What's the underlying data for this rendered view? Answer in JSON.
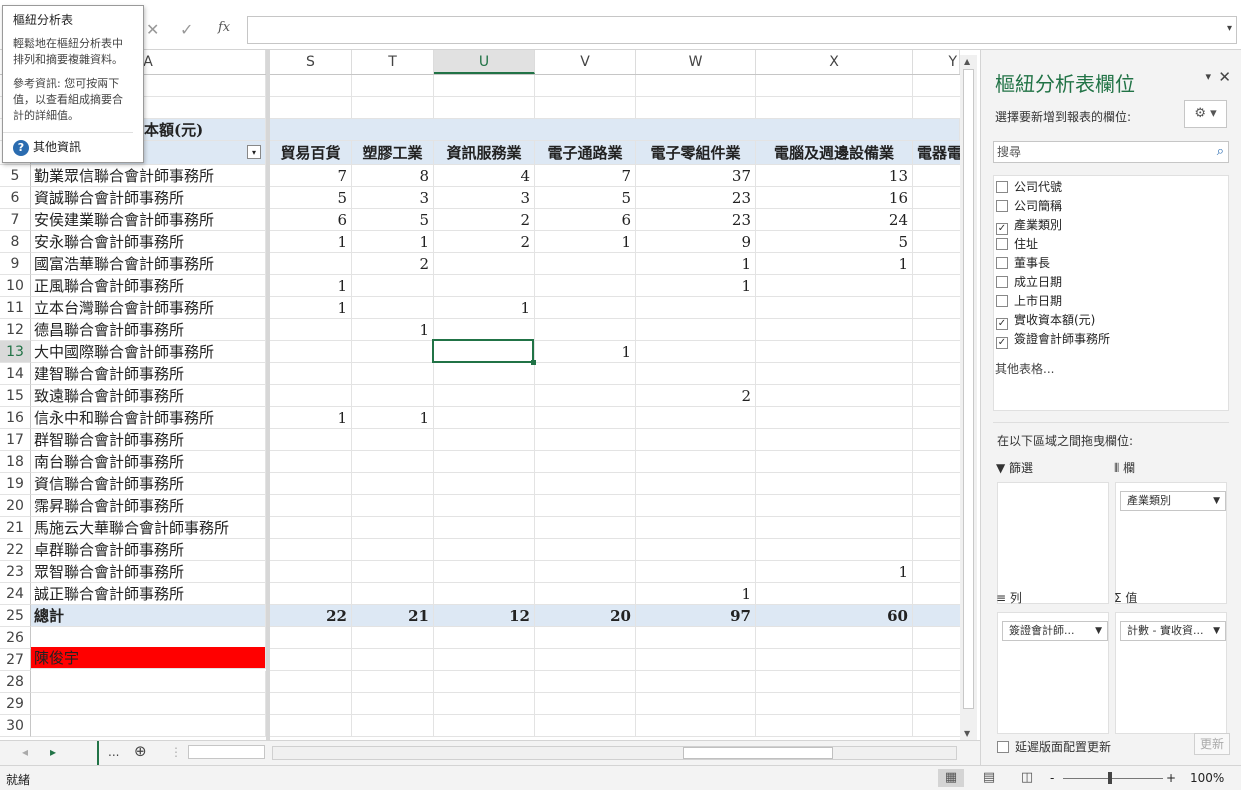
{
  "tooltip": {
    "title": "樞紐分析表",
    "body": "輕鬆地在樞紐分析表中排列和摘要複雜資料。",
    "body2": "參考資訊: 您可按兩下值，以查看組成摘要合計的詳細值。",
    "link": "其他資訊"
  },
  "formula": {
    "cancel": "✕",
    "enter": "✓",
    "fx": "fx",
    "value": ""
  },
  "columns": {
    "A": "A",
    "S": "S",
    "T": "T",
    "U": "U",
    "V": "V",
    "W": "W",
    "X": "X",
    "Y": "Y"
  },
  "rows": [
    "5",
    "6",
    "7",
    "8",
    "9",
    "10",
    "11",
    "12",
    "13",
    "14",
    "15",
    "16",
    "17",
    "18",
    "19",
    "20",
    "21",
    "22",
    "23",
    "24",
    "25",
    "26",
    "27",
    "28",
    "29",
    "30"
  ],
  "pivot": {
    "value_header": "本額(元)",
    "categories": [
      "貿易百貨",
      "塑膠工業",
      "資訊服務業",
      "電子通路業",
      "電子零組件業",
      "電腦及週邊設備業",
      "電器電"
    ],
    "firms": [
      {
        "name": "勤業眾信聯合會計師事務所",
        "v": [
          "7",
          "8",
          "4",
          "7",
          "37",
          "13"
        ]
      },
      {
        "name": "資誠聯合會計師事務所",
        "v": [
          "5",
          "3",
          "3",
          "5",
          "23",
          "16"
        ]
      },
      {
        "name": "安侯建業聯合會計師事務所",
        "v": [
          "6",
          "5",
          "2",
          "6",
          "23",
          "24"
        ]
      },
      {
        "name": "安永聯合會計師事務所",
        "v": [
          "1",
          "1",
          "2",
          "1",
          "9",
          "5"
        ]
      },
      {
        "name": "國富浩華聯合會計師事務所",
        "v": [
          "",
          "2",
          "",
          "",
          "1",
          "1"
        ]
      },
      {
        "name": "正風聯合會計師事務所",
        "v": [
          "1",
          "",
          "",
          "",
          "1",
          ""
        ]
      },
      {
        "name": "立本台灣聯合會計師事務所",
        "v": [
          "1",
          "",
          "1",
          "",
          "",
          ""
        ]
      },
      {
        "name": "德昌聯合會計師事務所",
        "v": [
          "",
          "1",
          "",
          "",
          "",
          ""
        ]
      },
      {
        "name": "大中國際聯合會計師事務所",
        "v": [
          "",
          "",
          "",
          "1",
          "",
          ""
        ]
      },
      {
        "name": "建智聯合會計師事務所",
        "v": [
          "",
          "",
          "",
          "",
          "",
          ""
        ]
      },
      {
        "name": "致遠聯合會計師事務所",
        "v": [
          "",
          "",
          "",
          "",
          "2",
          ""
        ]
      },
      {
        "name": "信永中和聯合會計師事務所",
        "v": [
          "1",
          "1",
          "",
          "",
          "",
          ""
        ]
      },
      {
        "name": "群智聯合會計師事務所",
        "v": [
          "",
          "",
          "",
          "",
          "",
          ""
        ]
      },
      {
        "name": "南台聯合會計師事務所",
        "v": [
          "",
          "",
          "",
          "",
          "",
          ""
        ]
      },
      {
        "name": "資信聯合會計師事務所",
        "v": [
          "",
          "",
          "",
          "",
          "",
          ""
        ]
      },
      {
        "name": "霈昇聯合會計師事務所",
        "v": [
          "",
          "",
          "",
          "",
          "",
          ""
        ]
      },
      {
        "name": "馬施云大華聯合會計師事務所",
        "v": [
          "",
          "",
          "",
          "",
          "",
          ""
        ]
      },
      {
        "name": "卓群聯合會計師事務所",
        "v": [
          "",
          "",
          "",
          "",
          "",
          ""
        ]
      },
      {
        "name": "眾智聯合會計師事務所",
        "v": [
          "",
          "",
          "",
          "",
          "",
          "1"
        ]
      },
      {
        "name": "誠正聯合會計師事務所",
        "v": [
          "",
          "",
          "",
          "",
          "1",
          ""
        ]
      }
    ],
    "total_label": "總計",
    "totals": [
      "22",
      "21",
      "12",
      "20",
      "97",
      "60"
    ]
  },
  "extra_cell": "陳俊宇",
  "sheetbar": {
    "more": "...",
    "add": "⊕"
  },
  "status": {
    "ready": "就緒",
    "zoom": "100%",
    "minus": "-",
    "plus": "+"
  },
  "pane": {
    "title": "樞紐分析表欄位",
    "choose": "選擇要新增到報表的欄位:",
    "search_placeholder": "搜尋",
    "fields": [
      {
        "label": "公司代號",
        "checked": false
      },
      {
        "label": "公司簡稱",
        "checked": false
      },
      {
        "label": "產業類別",
        "checked": true
      },
      {
        "label": "住址",
        "checked": false
      },
      {
        "label": "董事長",
        "checked": false
      },
      {
        "label": "成立日期",
        "checked": false
      },
      {
        "label": "上市日期",
        "checked": false
      },
      {
        "label": "實收資本額(元)",
        "checked": true
      },
      {
        "label": "簽證會計師事務所",
        "checked": true
      }
    ],
    "more_tables": "其他表格...",
    "drag_hint": "在以下區域之間拖曳欄位:",
    "areas": {
      "filter": "篩選",
      "columns": "欄",
      "rows": "列",
      "values": "值",
      "columns_chip": "產業類別",
      "rows_chip": "簽證會計師...",
      "values_chip": "計數 - 實收資..."
    },
    "defer": "延遲版面配置更新",
    "update": "更新"
  }
}
